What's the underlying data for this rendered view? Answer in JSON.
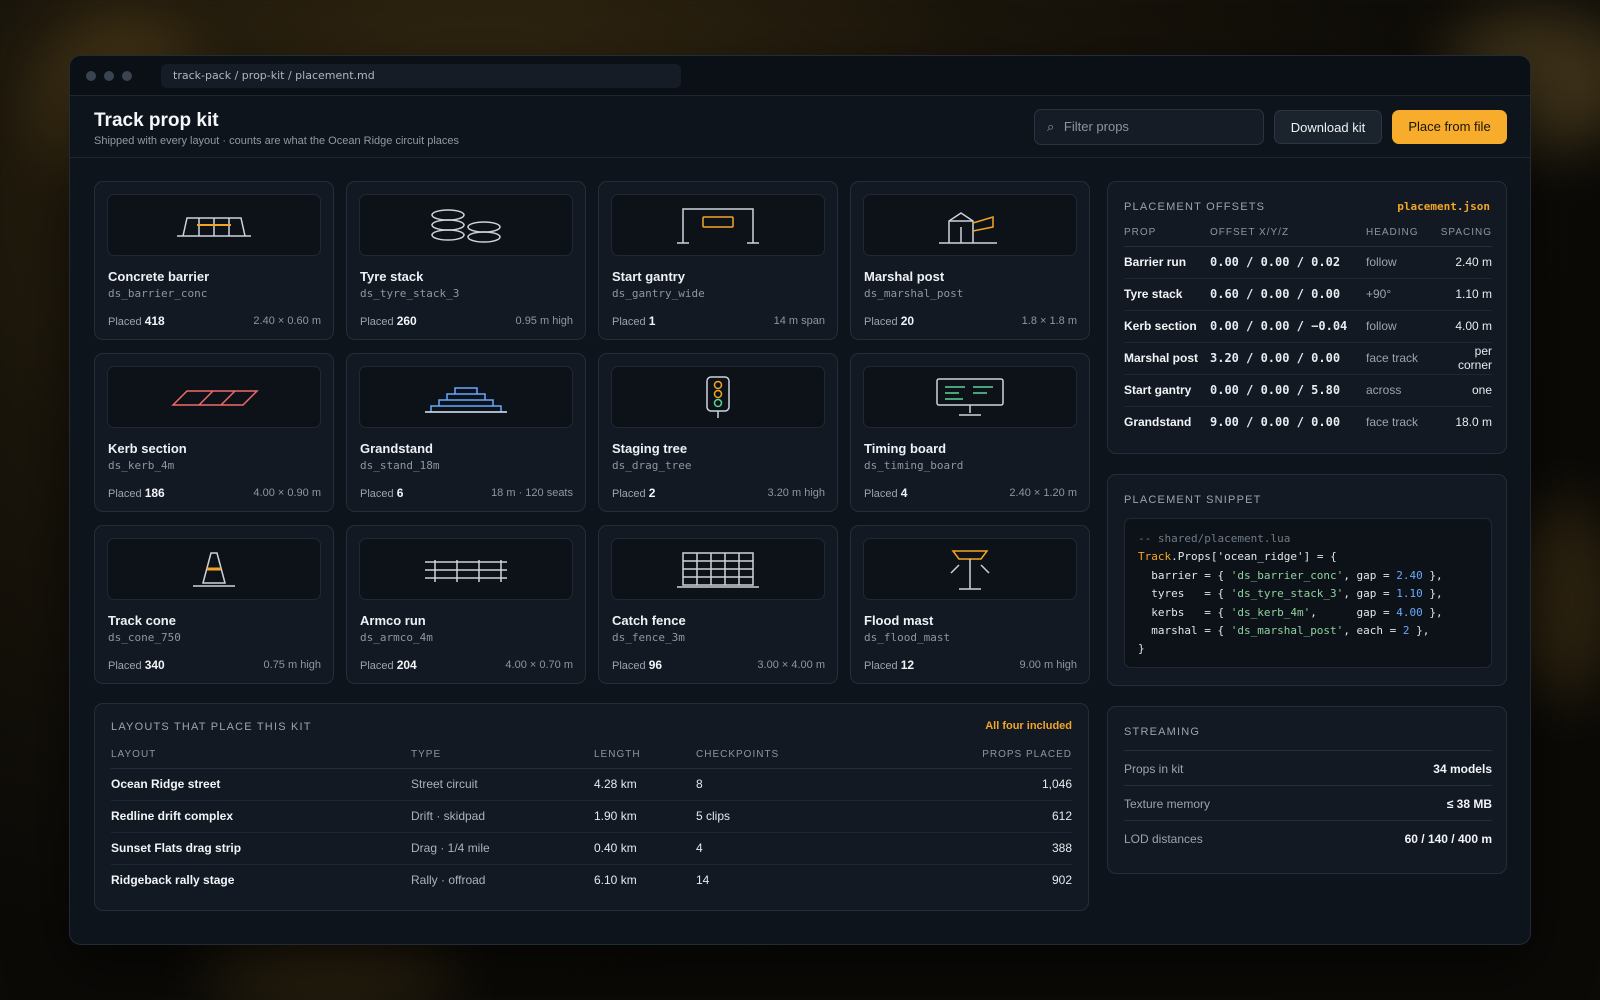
{
  "window": {
    "path": "track-pack / prop-kit / placement.md"
  },
  "header": {
    "title": "Track prop kit",
    "subtitle": "Shipped with every layout · counts are what the Ocean Ridge circuit places",
    "filter_placeholder": "Filter props",
    "search_icon": "⌕",
    "download_label": "Download kit",
    "place_label": "Place from file"
  },
  "props": [
    {
      "name": "Concrete barrier",
      "code": "ds_barrier_conc",
      "placed_label": "Placed",
      "placed": "418",
      "dim": "2.40 × 0.60 m",
      "icon": "barrier-icon"
    },
    {
      "name": "Tyre stack",
      "code": "ds_tyre_stack_3",
      "placed_label": "Placed",
      "placed": "260",
      "dim": "0.95 m high",
      "icon": "tyre-stack-icon"
    },
    {
      "name": "Start gantry",
      "code": "ds_gantry_wide",
      "placed_label": "Placed",
      "placed": "1",
      "dim": "14 m span",
      "icon": "gantry-icon"
    },
    {
      "name": "Marshal post",
      "code": "ds_marshal_post",
      "placed_label": "Placed",
      "placed": "20",
      "dim": "1.8 × 1.8 m",
      "icon": "marshal-post-icon"
    },
    {
      "name": "Kerb section",
      "code": "ds_kerb_4m",
      "placed_label": "Placed",
      "placed": "186",
      "dim": "4.00 × 0.90 m",
      "icon": "kerb-icon"
    },
    {
      "name": "Grandstand",
      "code": "ds_stand_18m",
      "placed_label": "Placed",
      "placed": "6",
      "dim": "18 m · 120 seats",
      "icon": "grandstand-icon"
    },
    {
      "name": "Staging tree",
      "code": "ds_drag_tree",
      "placed_label": "Placed",
      "placed": "2",
      "dim": "3.20 m high",
      "icon": "staging-tree-icon"
    },
    {
      "name": "Timing board",
      "code": "ds_timing_board",
      "placed_label": "Placed",
      "placed": "4",
      "dim": "2.40 × 1.20 m",
      "icon": "timing-board-icon"
    },
    {
      "name": "Track cone",
      "code": "ds_cone_750",
      "placed_label": "Placed",
      "placed": "340",
      "dim": "0.75 m high",
      "icon": "cone-icon"
    },
    {
      "name": "Armco run",
      "code": "ds_armco_4m",
      "placed_label": "Placed",
      "placed": "204",
      "dim": "4.00 × 0.70 m",
      "icon": "armco-icon"
    },
    {
      "name": "Catch fence",
      "code": "ds_fence_3m",
      "placed_label": "Placed",
      "placed": "96",
      "dim": "3.00 × 4.00 m",
      "icon": "fence-icon"
    },
    {
      "name": "Flood mast",
      "code": "ds_flood_mast",
      "placed_label": "Placed",
      "placed": "12",
      "dim": "9.00 m high",
      "icon": "flood-mast-icon"
    }
  ],
  "layouts": {
    "title": "LAYOUTS THAT PLACE THIS KIT",
    "aside": "All four included",
    "columns": [
      "LAYOUT",
      "TYPE",
      "LENGTH",
      "CHECKPOINTS",
      "PROPS PLACED"
    ],
    "rows": [
      {
        "layout": "Ocean Ridge street",
        "type": "Street circuit",
        "length": "4.28 km",
        "checkpoints": "8",
        "props": "1,046"
      },
      {
        "layout": "Redline drift complex",
        "type": "Drift · skidpad",
        "length": "1.90 km",
        "checkpoints": "5 clips",
        "props": "612"
      },
      {
        "layout": "Sunset Flats drag strip",
        "type": "Drag · 1/4 mile",
        "length": "0.40 km",
        "checkpoints": "4",
        "props": "388"
      },
      {
        "layout": "Ridgeback rally stage",
        "type": "Rally · offroad",
        "length": "6.10 km",
        "checkpoints": "14",
        "props": "902"
      }
    ]
  },
  "offsets": {
    "title": "PLACEMENT OFFSETS",
    "aside": "placement.json",
    "columns": [
      "PROP",
      "OFFSET X/Y/Z",
      "HEADING",
      "SPACING"
    ],
    "rows": [
      {
        "prop": "Barrier run",
        "offset": "0.00 / 0.00 / 0.02",
        "heading": "follow",
        "spacing": "2.40 m"
      },
      {
        "prop": "Tyre stack",
        "offset": "0.60 / 0.00 / 0.00",
        "heading": "+90°",
        "spacing": "1.10 m"
      },
      {
        "prop": "Kerb section",
        "offset": "0.00 / 0.00 / −0.04",
        "heading": "follow",
        "spacing": "4.00 m"
      },
      {
        "prop": "Marshal post",
        "offset": "3.20 / 0.00 / 0.00",
        "heading": "face track",
        "spacing": "per corner"
      },
      {
        "prop": "Start gantry",
        "offset": "0.00 / 0.00 / 5.80",
        "heading": "across",
        "spacing": "one"
      },
      {
        "prop": "Grandstand",
        "offset": "9.00 / 0.00 / 0.00",
        "heading": "face track",
        "spacing": "18.0 m"
      }
    ]
  },
  "snippet": {
    "title": "PLACEMENT SNIPPET",
    "comment": "-- shared/placement.lua",
    "line1_kw": "Track",
    "line1_rest": ".Props['ocean_ridge'] = {",
    "lines": [
      {
        "pre": "  barrier = { ",
        "str": "'ds_barrier_conc'",
        "mid": ", gap = ",
        "num": "2.40",
        "post": " },"
      },
      {
        "pre": "  tyres   = { ",
        "str": "'ds_tyre_stack_3'",
        "mid": ", gap = ",
        "num": "1.10",
        "post": " },"
      },
      {
        "pre": "  kerbs   = { ",
        "str": "'ds_kerb_4m'",
        "mid": ",      gap = ",
        "num": "4.00",
        "post": " },"
      },
      {
        "pre": "  marshal = { ",
        "str": "'ds_marshal_post'",
        "mid": ", each = ",
        "num": "2",
        "post": " },"
      }
    ],
    "close": "}"
  },
  "streaming": {
    "title": "STREAMING",
    "rows": [
      {
        "key": "Props in kit",
        "value": "34 models"
      },
      {
        "key": "Texture memory",
        "value": "≤ 38 MB"
      },
      {
        "key": "LOD distances",
        "value": "60 / 140 / 400 m"
      }
    ]
  },
  "colors": {
    "accent": "#f7ad2b",
    "background": "#0e141b",
    "card": "#121922"
  }
}
